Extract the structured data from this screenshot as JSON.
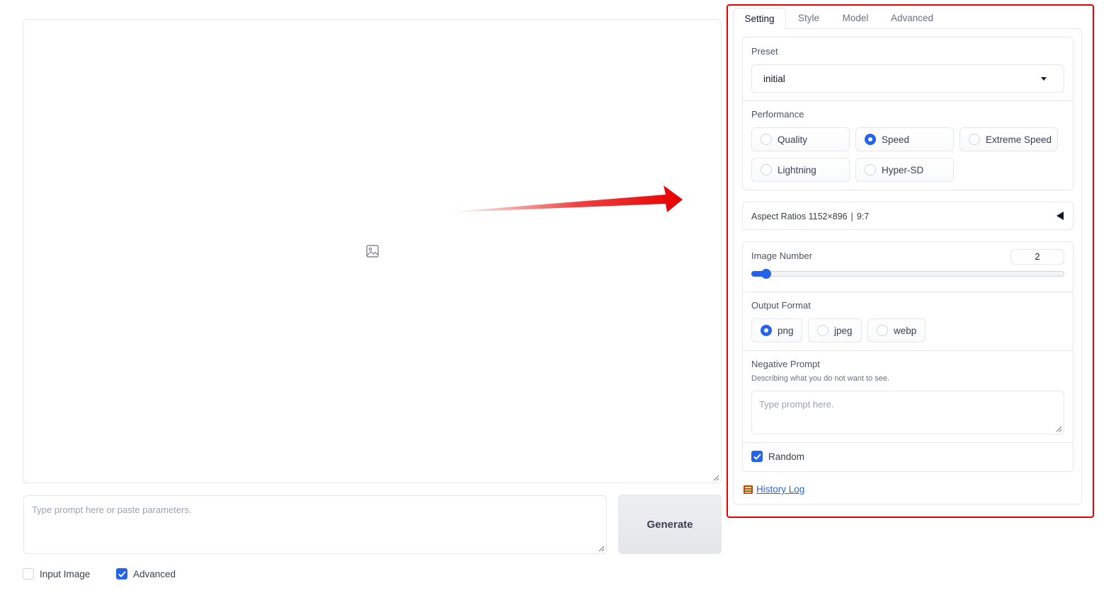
{
  "gallery": {
    "icon": "image-icon"
  },
  "prompt": {
    "placeholder": "Type prompt here or paste parameters.",
    "value": ""
  },
  "generate_label": "Generate",
  "options": {
    "input_image_label": "Input Image",
    "input_image_checked": false,
    "advanced_label": "Advanced",
    "advanced_checked": true
  },
  "tabs": [
    {
      "label": "Setting",
      "active": true
    },
    {
      "label": "Style",
      "active": false
    },
    {
      "label": "Model",
      "active": false
    },
    {
      "label": "Advanced",
      "active": false
    }
  ],
  "setting": {
    "preset": {
      "label": "Preset",
      "value": "initial"
    },
    "performance": {
      "label": "Performance",
      "options": [
        "Quality",
        "Speed",
        "Extreme Speed",
        "Lightning",
        "Hyper-SD"
      ],
      "selected": "Speed"
    },
    "aspect_ratios": {
      "label": "Aspect Ratios 1152×896 ∣ 9:7",
      "collapsed_icon": "triangle-left-icon"
    },
    "image_number": {
      "label": "Image Number",
      "value": "2",
      "fraction": 0.03
    },
    "output_format": {
      "label": "Output Format",
      "options": [
        "png",
        "jpeg",
        "webp"
      ],
      "selected": "png"
    },
    "negative_prompt": {
      "label": "Negative Prompt",
      "info": "Describing what you do not want to see.",
      "placeholder": "Type prompt here.",
      "value": ""
    },
    "random": {
      "label": "Random",
      "checked": true
    },
    "history_log": {
      "label": "History Log",
      "icon": "book-icon"
    }
  },
  "colors": {
    "accent": "#2563eb",
    "highlight": "#e60000"
  }
}
